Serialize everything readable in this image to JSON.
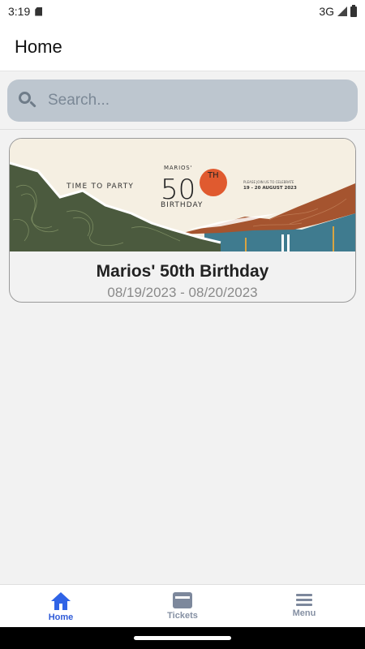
{
  "status_bar": {
    "time": "3:19",
    "network": "3G"
  },
  "app_bar": {
    "title": "Home"
  },
  "search": {
    "placeholder": "Search..."
  },
  "events": [
    {
      "title": "Marios' 50th Birthday",
      "dates": "08/19/2023 - 08/20/2023",
      "banner": {
        "left_text": "TIME TO PARTY",
        "name": "MARIOS'",
        "number": "50",
        "suffix": "TH",
        "subtitle": "BIRTHDAY",
        "invite": "PLEASE JOIN US TO CELEBRATE",
        "date_range": "19 - 20 AUGUST 2023"
      }
    }
  ],
  "bottom_nav": {
    "items": [
      {
        "label": "Home",
        "icon": "home-icon",
        "active": true
      },
      {
        "label": "Tickets",
        "icon": "ticket-icon",
        "active": false
      },
      {
        "label": "Menu",
        "icon": "menu-icon",
        "active": false
      }
    ]
  },
  "colors": {
    "accent": "#2f63e6",
    "search_bg": "#bdc6cf",
    "nav_inactive": "#7d889c",
    "banner_cream": "#f5efe2",
    "banner_olive": "#4b5a3e",
    "banner_rust": "#a5542f",
    "banner_teal": "#3f7b8f",
    "sun_orange": "#e05a2f"
  }
}
